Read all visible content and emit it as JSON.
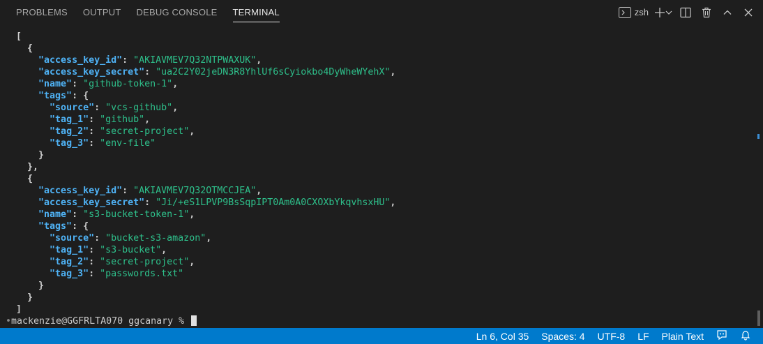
{
  "tabs": [
    {
      "label": "PROBLEMS",
      "active": false
    },
    {
      "label": "OUTPUT",
      "active": false
    },
    {
      "label": "DEBUG CONSOLE",
      "active": false
    },
    {
      "label": "TERMINAL",
      "active": true
    }
  ],
  "toolbar": {
    "shell_label": "zsh",
    "icons": [
      "terminal-icon",
      "plus-icon",
      "chevron-down-icon",
      "split-icon",
      "trash-icon",
      "chevron-up-icon",
      "close-icon"
    ]
  },
  "terminal": {
    "colors": {
      "key": "#4fb3f6",
      "string": "#2ec08b",
      "punct": "#cccccc"
    },
    "records": [
      {
        "open": "{",
        "access_key_id_label": "\"access_key_id\"",
        "access_key_id": "\"AKIAVMEV7Q32NTPWAXUK\"",
        "access_key_secret_label": "\"access_key_secret\"",
        "access_key_secret": "\"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\"",
        "name_label": "\"name\"",
        "name": "\"github-token-1\"",
        "tags_label": "\"tags\"",
        "source_label": "\"source\"",
        "source": "\"vcs-github\"",
        "tag_1_label": "\"tag_1\"",
        "tag_1": "\"github\"",
        "tag_2_label": "\"tag_2\"",
        "tag_2": "\"secret-project\"",
        "tag_3_label": "\"tag_3\"",
        "tag_3": "\"env-file\"",
        "close": "},"
      },
      {
        "open": "{",
        "access_key_id_label": "\"access_key_id\"",
        "access_key_id": "\"AKIAVMEV7Q32OTMCCJEA\"",
        "access_key_secret_label": "\"access_key_secret\"",
        "access_key_secret": "\"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\"",
        "name_label": "\"name\"",
        "name": "\"s3-bucket-token-1\"",
        "tags_label": "\"tags\"",
        "source_label": "\"source\"",
        "source": "\"bucket-s3-amazon\"",
        "tag_1_label": "\"tag_1\"",
        "tag_1": "\"s3-bucket\"",
        "tag_2_label": "\"tag_2\"",
        "tag_2": "\"secret-project\"",
        "tag_3_label": "\"tag_3\"",
        "tag_3": "\"passwords.txt\"",
        "close": "}"
      }
    ],
    "array_open": "[",
    "array_close": "]",
    "prompt": "mackenzie@GGFRLTA070 ggcanary % "
  },
  "statusbar": {
    "position": "Ln 6, Col 35",
    "spaces": "Spaces: 4",
    "encoding": "UTF-8",
    "eol": "LF",
    "language": "Plain Text",
    "icons": [
      "feedback-icon",
      "bell-icon"
    ]
  }
}
